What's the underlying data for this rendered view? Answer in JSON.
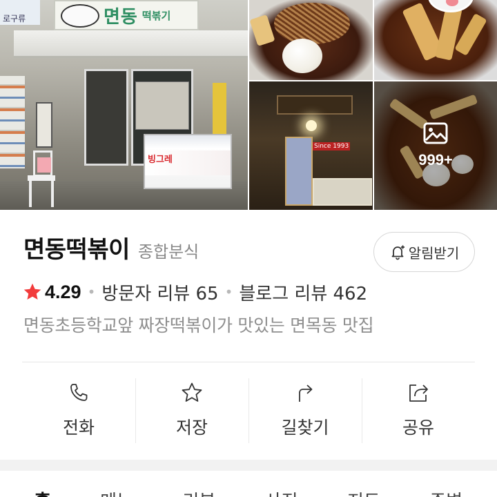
{
  "gallery": {
    "more_count": "999+",
    "storefront_sign": {
      "name": "면동",
      "sub": "떡볶기"
    },
    "left_sign": "로구류",
    "freezer_brand": "빙그레",
    "night_sign": "Since 1993"
  },
  "place": {
    "name": "면동떡볶이",
    "category": "종합분식",
    "notify_label": "알림받기",
    "rating": "4.29",
    "visitor_reviews": "방문자 리뷰 65",
    "blog_reviews": "블로그 리뷰 462",
    "tagline": "면동초등학교앞 짜장떡볶이가 맛있는 면목동 맛집",
    "rating_color": "#f23b3b"
  },
  "actions": [
    {
      "label": "전화",
      "icon": "phone-icon"
    },
    {
      "label": "저장",
      "icon": "star-outline-icon"
    },
    {
      "label": "길찾기",
      "icon": "directions-icon"
    },
    {
      "label": "공유",
      "icon": "share-icon"
    }
  ],
  "tabs": [
    "홈",
    "메뉴",
    "리뷰",
    "사진",
    "지도",
    "주변"
  ]
}
